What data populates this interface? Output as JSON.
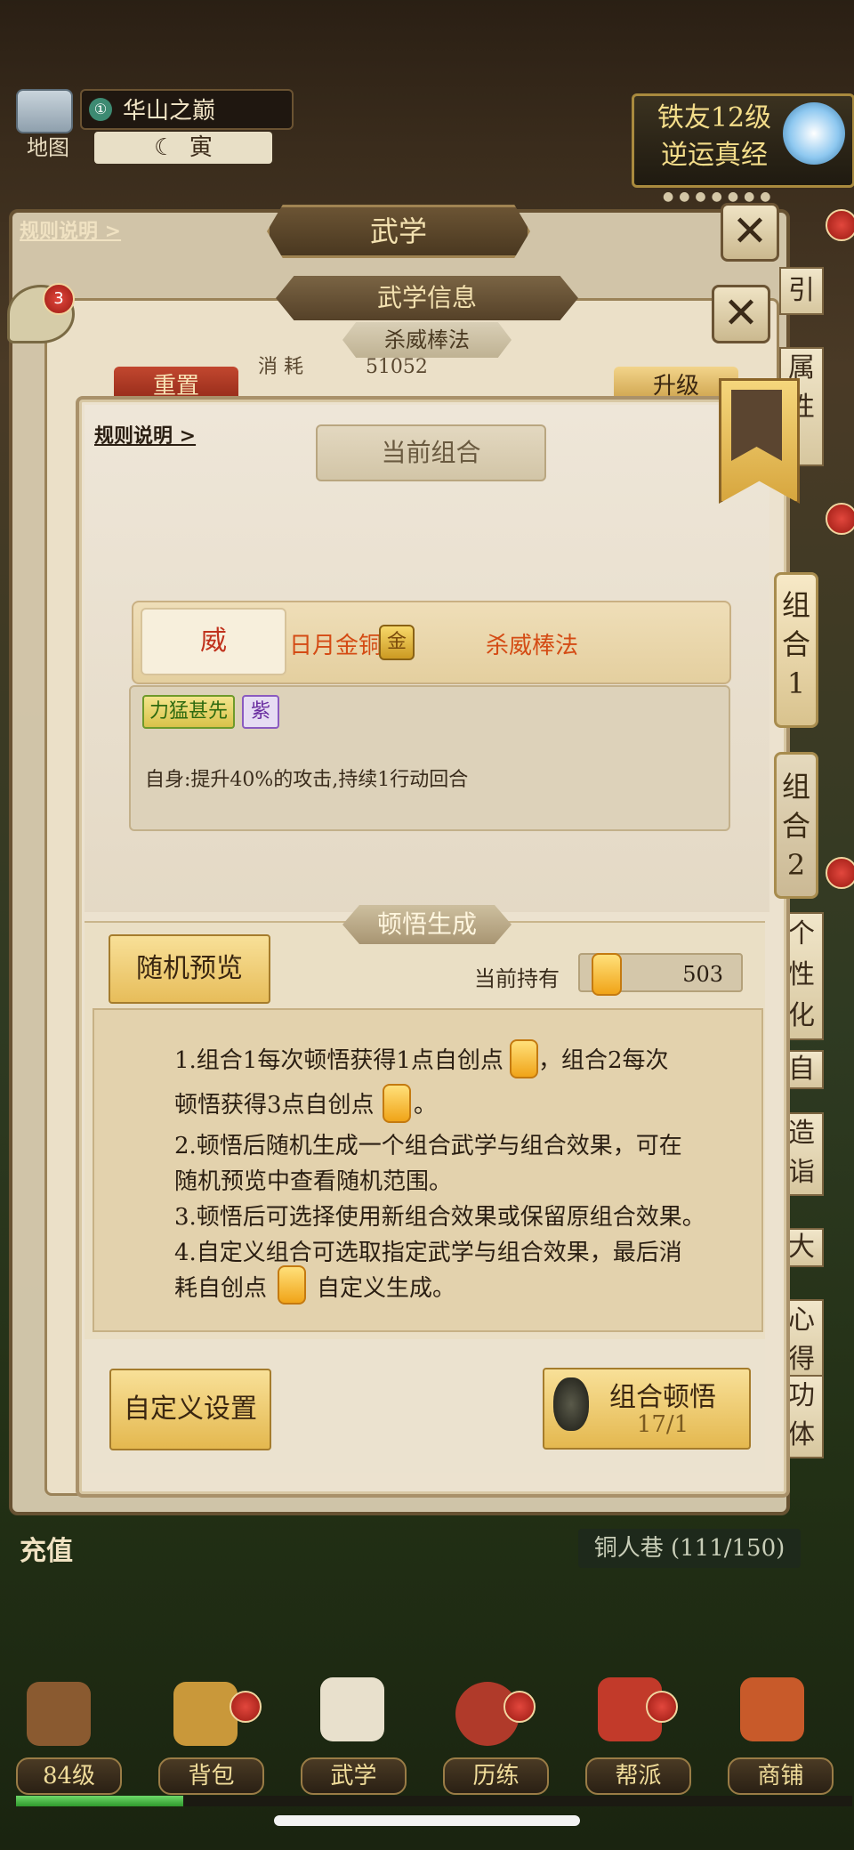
{
  "top": {
    "map_label": "地图",
    "location": "华山之巅",
    "location_icon": "①",
    "time": "寅",
    "time_icon": "☾",
    "banner_line1": "铁友12级",
    "banner_line2": "逆运真经",
    "banner_dots": "●●●●●●●"
  },
  "back": {
    "rule_link": "规则说明 >",
    "title": "武学",
    "info_title": "武学信息",
    "skill_name": "杀威棒法",
    "consume_label": "消 耗",
    "consume_value": "51052",
    "reset_label": "重置",
    "upgrade_label": "升级",
    "bubble_badge": "3",
    "side_tabs": [
      "引",
      "属性",
      "个性化",
      "自",
      "造诣",
      "大",
      "心得",
      "功体"
    ]
  },
  "modal": {
    "rule_link": "规则说明 >",
    "current_combo": "当前组合",
    "combo_tabs": [
      {
        "label": [
          "组",
          "合",
          "1"
        ]
      },
      {
        "label": [
          "组",
          "合",
          "2"
        ]
      }
    ],
    "combo": {
      "attr": "威",
      "weapon": "日月金铜",
      "grade_chip": "金",
      "skill": "杀威棒法"
    },
    "effect": {
      "tag": "力猛甚先",
      "quality": "紫",
      "text": "自身:提升40%的攻击,持续1行动回合"
    },
    "generation": {
      "title": "顿悟生成",
      "random_preview": "随机预览",
      "holding_label": "当前持有",
      "holding_value": "503",
      "rules": [
        "1.组合1每次顿悟获得1点自创点",
        "，组合2每次",
        "顿悟获得3点自创点",
        "。",
        "2.顿悟后随机生成一个组合武学与组合效果，可在",
        "随机预览中查看随机范围。",
        "3.顿悟后可选择使用新组合效果或保留原组合效果。",
        "4.自定义组合可选取指定武学与组合效果，最后消",
        "耗自创点",
        "自定义生成。"
      ]
    },
    "custom_button": "自定义设置",
    "combo_button": {
      "label": "组合顿悟",
      "count": "17/1"
    }
  },
  "bottom": {
    "charge": "充值",
    "stage": "铜人巷 (111/150)",
    "nav": [
      {
        "label": "84级",
        "icon": "hat-icon",
        "color": "#8a5a30"
      },
      {
        "label": "背包",
        "icon": "bag-icon",
        "color": "#c9983a"
      },
      {
        "label": "武学",
        "icon": "scroll-icon",
        "color": "#e8e0cc"
      },
      {
        "label": "历练",
        "icon": "drum-icon",
        "color": "#b03a2a"
      },
      {
        "label": "帮派",
        "icon": "banner-icon",
        "color": "#c23a2a"
      },
      {
        "label": "商铺",
        "icon": "shop-icon",
        "color": "#c85a2a"
      }
    ],
    "xp_progress": 0.2
  }
}
